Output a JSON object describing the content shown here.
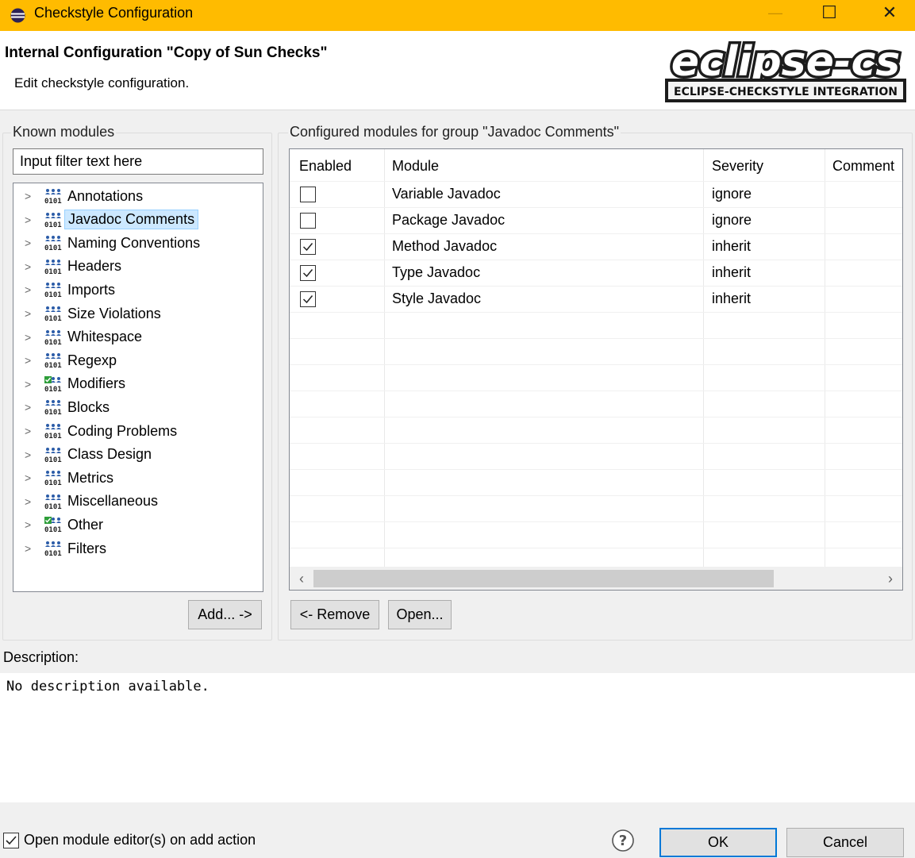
{
  "window": {
    "title": "Checkstyle Configuration",
    "controls": {
      "minimize": "—",
      "maximize": "☐",
      "close": "✕"
    }
  },
  "banner": {
    "heading": "Internal Configuration \"Copy of Sun Checks\"",
    "subtitle": "Edit checkstyle configuration.",
    "logo_main": "eclipse-cs",
    "logo_sub": "ECLIPSE-CHECKSTYLE INTEGRATION"
  },
  "known_modules": {
    "label": "Known modules",
    "filter_value": "Input filter text here",
    "items": [
      {
        "label": "Annotations",
        "icon": "module-group-icon"
      },
      {
        "label": "Javadoc Comments",
        "icon": "module-group-icon",
        "selected": true
      },
      {
        "label": "Naming Conventions",
        "icon": "module-group-icon"
      },
      {
        "label": "Headers",
        "icon": "module-group-icon"
      },
      {
        "label": "Imports",
        "icon": "module-group-icon"
      },
      {
        "label": "Size Violations",
        "icon": "module-group-icon"
      },
      {
        "label": "Whitespace",
        "icon": "module-group-icon"
      },
      {
        "label": "Regexp",
        "icon": "module-group-icon"
      },
      {
        "label": "Modifiers",
        "icon": "module-group-active-icon"
      },
      {
        "label": "Blocks",
        "icon": "module-group-icon"
      },
      {
        "label": "Coding Problems",
        "icon": "module-group-icon"
      },
      {
        "label": "Class Design",
        "icon": "module-group-icon"
      },
      {
        "label": "Metrics",
        "icon": "module-group-icon"
      },
      {
        "label": "Miscellaneous",
        "icon": "module-group-icon"
      },
      {
        "label": "Other",
        "icon": "module-group-active-icon"
      },
      {
        "label": "Filters",
        "icon": "module-group-icon"
      }
    ],
    "add_button": "Add... ->"
  },
  "configured_modules": {
    "label": "Configured modules for group \"Javadoc Comments\"",
    "columns": [
      "Enabled",
      "Module",
      "Severity",
      "Comment"
    ],
    "rows": [
      {
        "enabled": false,
        "module": "Variable Javadoc",
        "severity": "ignore",
        "comment": ""
      },
      {
        "enabled": false,
        "module": "Package Javadoc",
        "severity": "ignore",
        "comment": ""
      },
      {
        "enabled": true,
        "module": "Method Javadoc",
        "severity": "inherit",
        "comment": ""
      },
      {
        "enabled": true,
        "module": "Type Javadoc",
        "severity": "inherit",
        "comment": ""
      },
      {
        "enabled": true,
        "module": "Style Javadoc",
        "severity": "inherit",
        "comment": ""
      }
    ],
    "remove_button": "<- Remove",
    "open_button": "Open..."
  },
  "description": {
    "label": "Description:",
    "text": "No description available."
  },
  "footer": {
    "open_editor_checked": true,
    "open_editor_label": "Open module editor(s) on add action",
    "help_glyph": "?",
    "ok_button": "OK",
    "cancel_button": "Cancel"
  }
}
